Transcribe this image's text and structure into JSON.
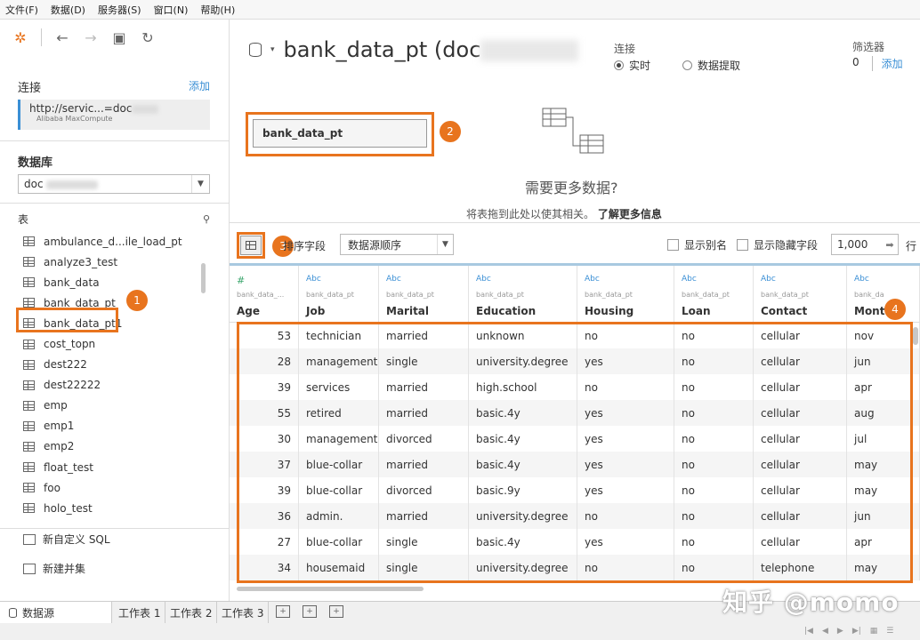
{
  "menu": [
    "文件(F)",
    "数据(D)",
    "服务器(S)",
    "窗口(N)",
    "帮助(H)"
  ],
  "left": {
    "connection_title": "连接",
    "connection_add": "添加",
    "connection_url": "http://servic...=doc",
    "connection_type": "Alibaba MaxCompute",
    "database_title": "数据库",
    "database_value": "doc",
    "tables_title": "表",
    "tables": [
      "ambulance_d...ile_load_pt",
      "analyze3_test",
      "bank_data",
      "bank_data_pt",
      "bank_data_pt1",
      "cost_topn",
      "dest222",
      "dest22222",
      "emp",
      "emp1",
      "emp2",
      "float_test",
      "foo",
      "holo_test"
    ],
    "new_sql": "新自定义 SQL",
    "new_union": "新建并集"
  },
  "header": {
    "title": "bank_data_pt (doc",
    "connection_label": "连接",
    "mode_live": "实时",
    "mode_extract": "数据提取",
    "filters_label": "筛选器",
    "filters_count": "0",
    "filters_add": "添加"
  },
  "canvas": {
    "table_name": "bank_data_pt",
    "need_more": "需要更多数据?",
    "drag_hint": "将表拖到此处以使其相关。",
    "learn_more": "了解更多信息"
  },
  "grid_toolbar": {
    "sort_label": "排序字段",
    "sort_value": "数据源顺序",
    "show_alias": "显示别名",
    "show_hidden": "显示隐藏字段",
    "rows_value": "1,000",
    "rows_label": "行"
  },
  "grid": {
    "columns": [
      {
        "type": "#",
        "source": "bank_data_...",
        "name": "Age"
      },
      {
        "type": "Abc",
        "source": "bank_data_pt",
        "name": "Job"
      },
      {
        "type": "Abc",
        "source": "bank_data_pt",
        "name": "Marital"
      },
      {
        "type": "Abc",
        "source": "bank_data_pt",
        "name": "Education"
      },
      {
        "type": "Abc",
        "source": "bank_data_pt",
        "name": "Housing"
      },
      {
        "type": "Abc",
        "source": "bank_data_pt",
        "name": "Loan"
      },
      {
        "type": "Abc",
        "source": "bank_data_pt",
        "name": "Contact"
      },
      {
        "type": "Abc",
        "source": "bank_da",
        "name": "Month"
      }
    ],
    "rows": [
      [
        "53",
        "technician",
        "married",
        "unknown",
        "no",
        "no",
        "cellular",
        "nov"
      ],
      [
        "28",
        "management",
        "single",
        "university.degree",
        "yes",
        "no",
        "cellular",
        "jun"
      ],
      [
        "39",
        "services",
        "married",
        "high.school",
        "no",
        "no",
        "cellular",
        "apr"
      ],
      [
        "55",
        "retired",
        "married",
        "basic.4y",
        "yes",
        "no",
        "cellular",
        "aug"
      ],
      [
        "30",
        "management",
        "divorced",
        "basic.4y",
        "yes",
        "no",
        "cellular",
        "jul"
      ],
      [
        "37",
        "blue-collar",
        "married",
        "basic.4y",
        "yes",
        "no",
        "cellular",
        "may"
      ],
      [
        "39",
        "blue-collar",
        "divorced",
        "basic.9y",
        "yes",
        "no",
        "cellular",
        "may"
      ],
      [
        "36",
        "admin.",
        "married",
        "university.degree",
        "no",
        "no",
        "cellular",
        "jun"
      ],
      [
        "27",
        "blue-collar",
        "single",
        "basic.4y",
        "yes",
        "no",
        "cellular",
        "apr"
      ],
      [
        "34",
        "housemaid",
        "single",
        "university.degree",
        "no",
        "no",
        "telephone",
        "may"
      ]
    ]
  },
  "bottom": {
    "datasource_tab": "数据源",
    "sheets": [
      "工作表 1",
      "工作表 2",
      "工作表 3"
    ]
  },
  "badges": [
    "1",
    "2",
    "3",
    "4"
  ],
  "watermark": "知乎 @momo",
  "colors": {
    "accent": "#e8741e",
    "link": "#3a8fd5"
  }
}
